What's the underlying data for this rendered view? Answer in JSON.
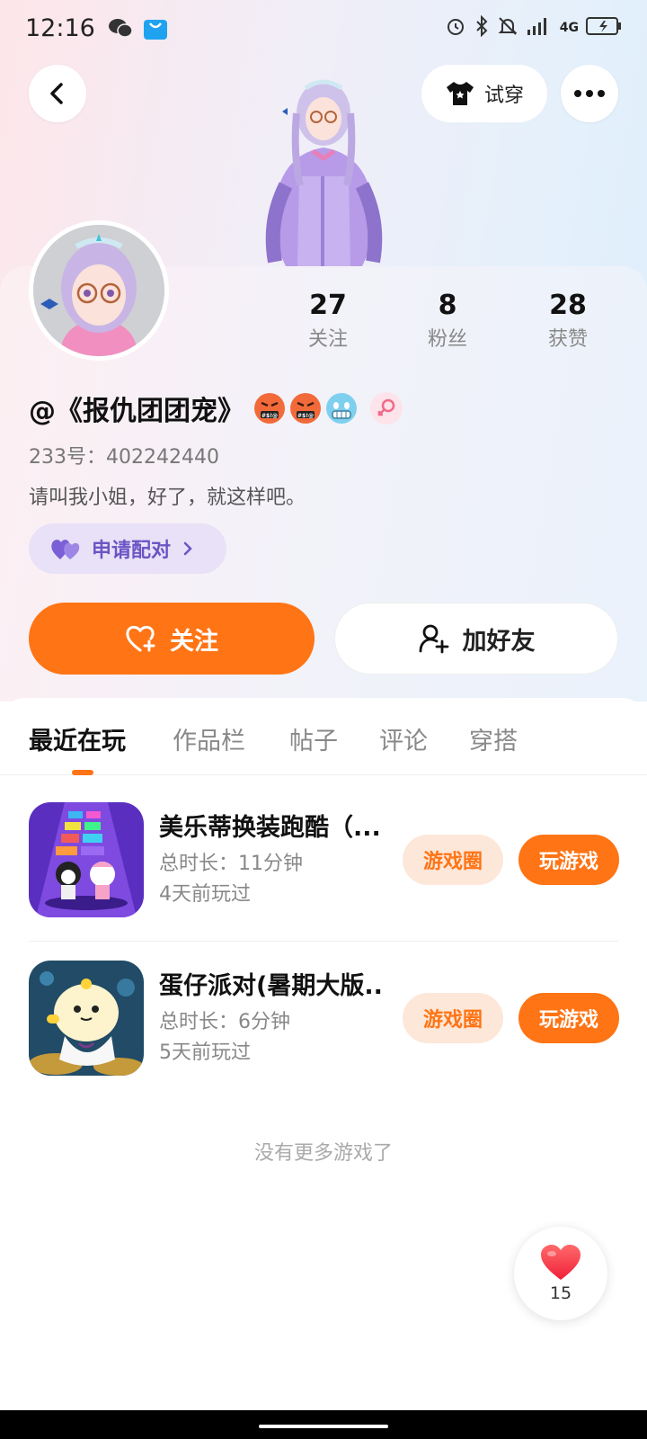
{
  "status_bar": {
    "time": "12:16",
    "network": "4G"
  },
  "header": {
    "try_on_label": "试穿"
  },
  "profile": {
    "stats": [
      {
        "value": "27",
        "label": "关注"
      },
      {
        "value": "8",
        "label": "粉丝"
      },
      {
        "value": "28",
        "label": "获赞"
      }
    ],
    "nickname": "@《报仇团团宠》",
    "uid": "233号：402242440",
    "bio": "请叫我小姐，好了，就这样吧。",
    "pair_label": "申请配对",
    "follow_label": "关注",
    "add_friend_label": "加好友"
  },
  "tabs": [
    "最近在玩",
    "作品栏",
    "帖子",
    "评论",
    "穿搭"
  ],
  "games": [
    {
      "title": "美乐蒂换装跑酷（...",
      "duration": "总时长：11分钟",
      "last_played": "4天前玩过",
      "circle_label": "游戏圈",
      "play_label": "玩游戏"
    },
    {
      "title": "蛋仔派对(暑期大版...",
      "duration": "总时长：6分钟",
      "last_played": "5天前玩过",
      "circle_label": "游戏圈",
      "play_label": "玩游戏"
    }
  ],
  "no_more_text": "没有更多游戏了",
  "like": {
    "count": "15"
  },
  "colors": {
    "accent": "#ff7414",
    "accent_soft": "#fde7d9",
    "pair_bg": "#e8e1f7",
    "pair_text": "#6a55c4"
  }
}
